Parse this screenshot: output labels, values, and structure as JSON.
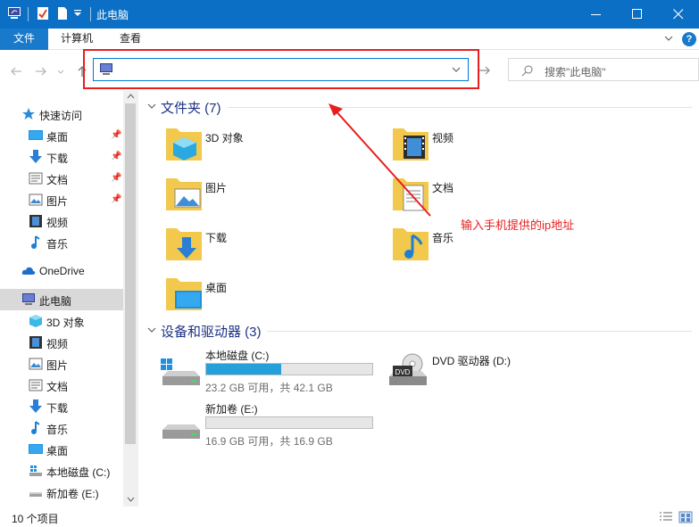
{
  "window": {
    "title": "此电脑",
    "accent": "#0b6fc6"
  },
  "ribbon": {
    "file_tab": "文件",
    "tabs": [
      "计算机",
      "查看"
    ],
    "help": "?"
  },
  "nav": {
    "address_value": "",
    "search_placeholder": "搜索\"此电脑\""
  },
  "sidebar": {
    "quick_access": "快速访问",
    "quick_items": [
      {
        "label": "桌面",
        "icon": "desktop-icon",
        "pinned": true
      },
      {
        "label": "下载",
        "icon": "download-icon",
        "pinned": true
      },
      {
        "label": "文档",
        "icon": "document-icon",
        "pinned": true
      },
      {
        "label": "图片",
        "icon": "picture-icon",
        "pinned": true
      },
      {
        "label": "视频",
        "icon": "video-icon",
        "pinned": false
      },
      {
        "label": "音乐",
        "icon": "music-icon",
        "pinned": false
      }
    ],
    "onedrive": "OneDrive",
    "this_pc": "此电脑",
    "pc_items": [
      {
        "label": "3D 对象",
        "icon": "3d-objects-icon"
      },
      {
        "label": "视频",
        "icon": "video-icon"
      },
      {
        "label": "图片",
        "icon": "picture-icon"
      },
      {
        "label": "文档",
        "icon": "document-icon"
      },
      {
        "label": "下载",
        "icon": "download-icon"
      },
      {
        "label": "音乐",
        "icon": "music-icon"
      },
      {
        "label": "桌面",
        "icon": "desktop-icon"
      },
      {
        "label": "本地磁盘 (C:)",
        "icon": "local-disk-icon"
      },
      {
        "label": "新加卷 (E:)",
        "icon": "drive-icon"
      }
    ]
  },
  "content": {
    "folders_header": "文件夹 (7)",
    "folders": [
      {
        "label": "3D 对象",
        "icon": "3d-objects-folder-icon"
      },
      {
        "label": "视频",
        "icon": "video-folder-icon"
      },
      {
        "label": "图片",
        "icon": "pictures-folder-icon"
      },
      {
        "label": "文档",
        "icon": "documents-folder-icon"
      },
      {
        "label": "下载",
        "icon": "downloads-folder-icon"
      },
      {
        "label": "音乐",
        "icon": "music-folder-icon"
      },
      {
        "label": "桌面",
        "icon": "desktop-folder-icon"
      }
    ],
    "devices_header": "设备和驱动器 (3)",
    "drives": [
      {
        "label": "本地磁盘 (C:)",
        "size": "23.2 GB 可用，共 42.1 GB",
        "used_fraction": 0.449
      },
      {
        "label": "DVD 驱动器 (D:)"
      },
      {
        "label": "新加卷 (E:)",
        "size": "16.9 GB 可用，共 16.9 GB",
        "used_fraction": 0.0
      }
    ]
  },
  "annotation": {
    "text": "输入手机提供的ip地址",
    "color": "#e81e1e"
  },
  "status": {
    "count": "10 个项目"
  }
}
